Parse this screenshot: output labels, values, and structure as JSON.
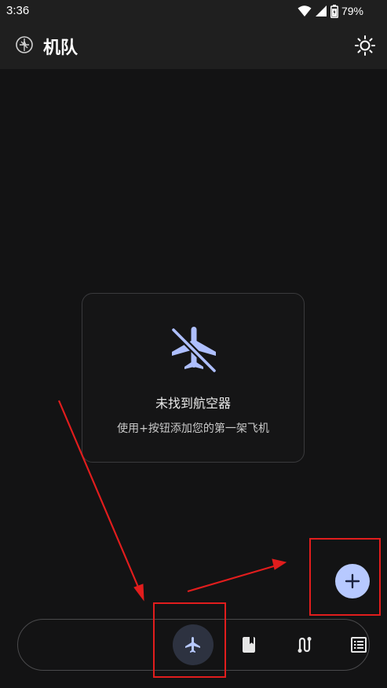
{
  "status_bar": {
    "time": "3:36",
    "battery_percent": "79%",
    "icons": [
      "wifi-icon",
      "signal-icon",
      "battery-icon"
    ]
  },
  "app_bar": {
    "title": "机队",
    "logo_icon": "airplane-logo-icon",
    "theme_toggle_icon": "sun-icon"
  },
  "empty_state": {
    "icon": "airplane-off-icon",
    "title": "未找到航空器",
    "subtitle": "使用+按钮添加您的第一架飞机"
  },
  "fab": {
    "icon": "plus-icon"
  },
  "bottom_nav": {
    "items": [
      {
        "icon": "airplane-icon",
        "active": true
      },
      {
        "icon": "logbook-icon",
        "active": false
      },
      {
        "icon": "route-icon",
        "active": false
      },
      {
        "icon": "list-icon",
        "active": false
      }
    ]
  },
  "colors": {
    "background": "#131314",
    "app_bar": "#1f1f1f",
    "accent": "#b7c9ff",
    "annotation": "#e11d1d"
  }
}
